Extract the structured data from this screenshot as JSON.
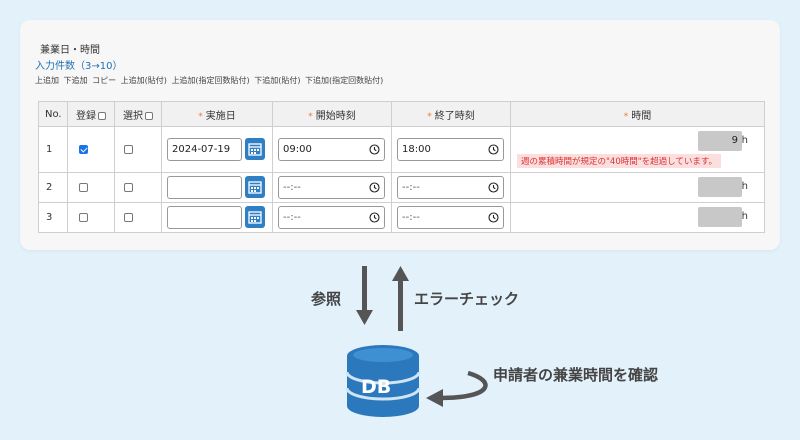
{
  "form": {
    "section_title": "兼業日・時間",
    "count_link": "入力件数（3→10）",
    "actions": [
      "上追加",
      "下追加",
      "コピー",
      "上追加(貼付)",
      "上追加(指定回数貼付)",
      "下追加(貼付)",
      "下追加(指定回数貼付)"
    ]
  },
  "table": {
    "headers": {
      "no": "No.",
      "register": "登録",
      "select": "選択",
      "date": "実施日",
      "start": "開始時刻",
      "end": "終了時刻",
      "hours": "時間"
    },
    "required_mark": "*",
    "time_placeholder": "--:--",
    "hour_unit": "h",
    "rows": [
      {
        "no": "1",
        "registered": true,
        "selected": false,
        "date": "2024-07-19",
        "start": "09:00",
        "end": "18:00",
        "hours": "9",
        "error": "週の累積時間が規定の\"40時間\"を超過しています。"
      },
      {
        "no": "2",
        "registered": false,
        "selected": false,
        "date": "",
        "start": "",
        "end": "",
        "hours": "",
        "error": ""
      },
      {
        "no": "3",
        "registered": false,
        "selected": false,
        "date": "",
        "start": "",
        "end": "",
        "hours": "",
        "error": ""
      }
    ]
  },
  "diagram": {
    "reference_label": "参照",
    "error_check_label": "エラーチェック",
    "db_label": "DB",
    "confirm_label": "申請者の兼業時間を確認",
    "colors": {
      "arrow": "#555555",
      "db": "#2b78bd",
      "db_light": "#cfe5f6"
    }
  },
  "icons": [
    "calendar-icon",
    "clock-icon",
    "checkbox-icon",
    "database-icon",
    "arrow-up-icon",
    "arrow-down-icon",
    "curved-arrow-icon"
  ]
}
